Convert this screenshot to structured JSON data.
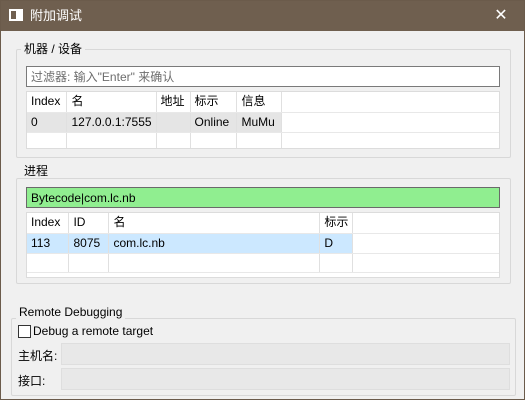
{
  "window": {
    "title": "附加调试",
    "close_symbol": "✕"
  },
  "devices": {
    "group_label": "机器 / 设备",
    "filter_placeholder": "过滤器: 输入\"Enter\" 来确认",
    "columns": [
      "Index",
      "名",
      "地址",
      "标示",
      "信息"
    ],
    "rows": [
      [
        "0",
        "127.0.0.1:7555",
        "",
        "Online",
        "MuMu"
      ]
    ]
  },
  "process": {
    "group_label": "进程",
    "filter_value": "Bytecode|com.lc.nb",
    "columns": [
      "Index",
      "ID",
      "名",
      "标示"
    ],
    "rows": [
      [
        "113",
        "8075",
        "com.lc.nb",
        "D"
      ]
    ]
  },
  "remote": {
    "group_label": "Remote Debugging",
    "checkbox_label": "Debug a remote target",
    "checked": false,
    "host_label": "主机名:",
    "port_label": "接口:"
  }
}
